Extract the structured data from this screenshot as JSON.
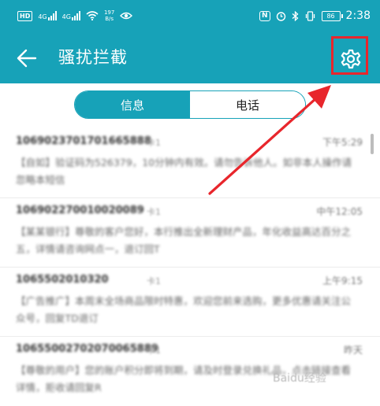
{
  "status_bar": {
    "carrier_badge": "HD",
    "net1": "4G",
    "net2": "4G",
    "speed_value": "197",
    "speed_unit": "B/s",
    "nfc": "N",
    "battery": "86",
    "time": "2:38"
  },
  "app_bar": {
    "title": "骚扰拦截",
    "back_icon": "back-arrow-icon",
    "settings_icon": "gear-icon"
  },
  "tabs": [
    {
      "label": "信息",
      "active": true
    },
    {
      "label": "电话",
      "active": false
    }
  ],
  "messages": [
    {
      "number": "1069023701701665888",
      "flag": "卡1",
      "time": "下午5:29",
      "preview": "【自如】验证码为526379，10分钟内有效。请勿告诉他人。如非本人操作请忽略本短信"
    },
    {
      "number": "106902270010020089",
      "flag": "卡1",
      "time": "中午12:05",
      "preview": "【某某银行】尊敬的客户您好，本行推出全新理财产品，年化收益高达百分之五，详情请咨询网点一，退订回T"
    },
    {
      "number": "1065502010320",
      "flag": "卡1",
      "time": "上午9:15",
      "preview": "【广告推广】本周末全场商品限时特惠，欢迎您前来选购，更多优惠请关注公众号，回复TD退订"
    },
    {
      "number": "10655002702070065889",
      "flag": "卡1",
      "time": "昨天",
      "preview": "【尊敬的用户】您的账户积分即将到期，请及时登录兑换礼品，点击链接查看详情，拒收请回复R"
    }
  ],
  "watermark": "Baidu经验",
  "colors": {
    "brand": "#17a2b8",
    "highlight": "#e8262c"
  }
}
